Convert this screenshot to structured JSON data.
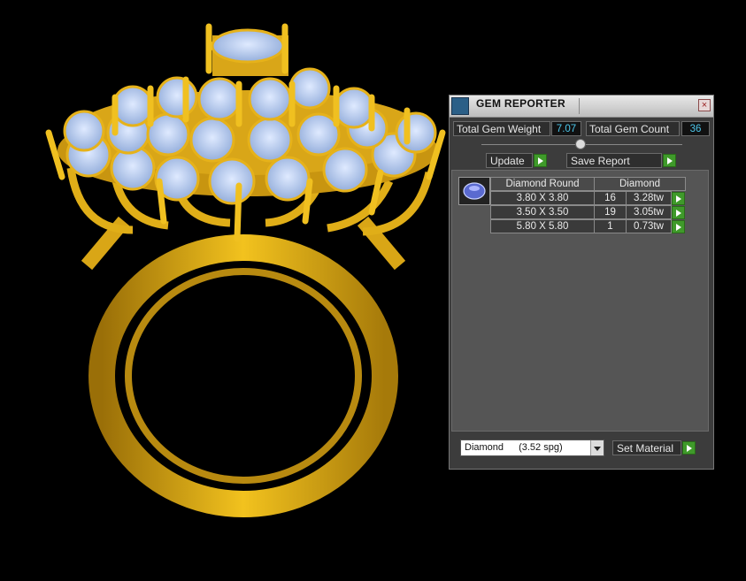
{
  "panel": {
    "title": "GEM REPORTER",
    "close_glyph": "×",
    "total_weight_label": "Total Gem Weight",
    "total_weight_value": "7.07",
    "total_count_label": "Total Gem Count",
    "total_count_value": "36",
    "update_label": "Update",
    "save_report_label": "Save Report",
    "table": {
      "headers": [
        "Diamond Round",
        "Diamond"
      ],
      "rows": [
        {
          "size": "3.80 X 3.80",
          "count": "16",
          "weight": "3.28tw"
        },
        {
          "size": "3.50 X 3.50",
          "count": "19",
          "weight": "3.05tw"
        },
        {
          "size": "5.80 X 5.80",
          "count": "1",
          "weight": "0.73tw"
        }
      ]
    },
    "material_select": {
      "name": "Diamond",
      "spg": "(3.52 spg)"
    },
    "set_material_label": "Set Material"
  },
  "colors": {
    "accent_value": "#4cc6ea",
    "go_button": "#3f9a2a",
    "gold": "#e6b21a",
    "gem": "#a9c8f0"
  },
  "icons": {
    "title_icon": "gem-reporter-icon",
    "close_icon": "close-icon",
    "go_icon": "play-arrow-icon",
    "gem_thumb": "round-diamond-icon"
  }
}
